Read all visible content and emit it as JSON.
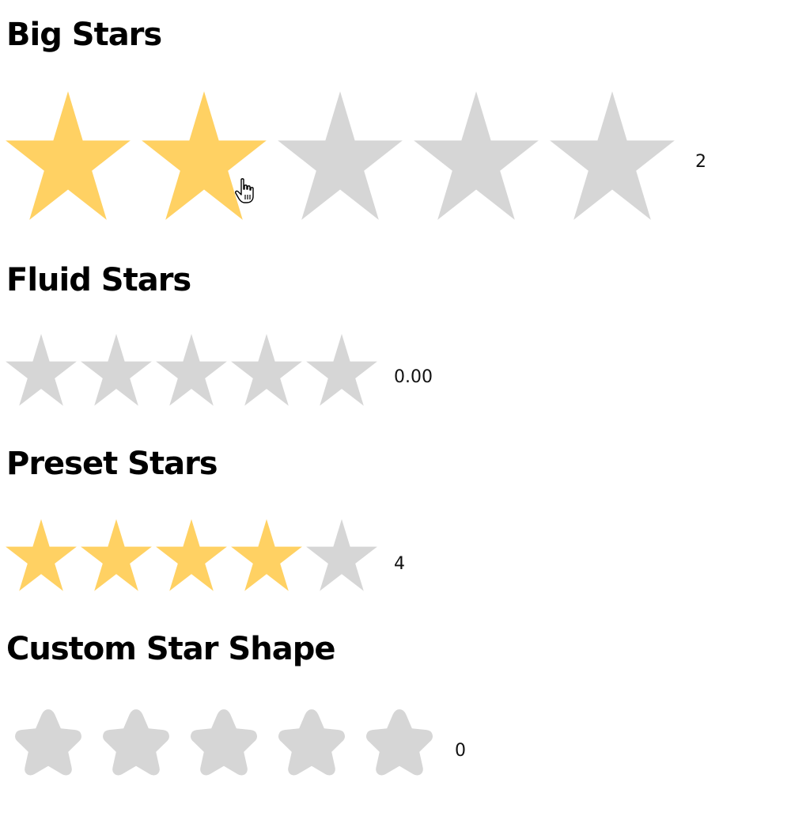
{
  "colors": {
    "filled": "#FFD163",
    "empty": "#D6D6D6"
  },
  "sections": [
    {
      "title": "Big Stars",
      "rating": 2,
      "max": 5,
      "value_text": "2",
      "shape": "classic-star-icon"
    },
    {
      "title": "Fluid Stars",
      "rating": 0,
      "max": 5,
      "value_text": "0.00",
      "shape": "classic-star-icon"
    },
    {
      "title": "Preset Stars",
      "rating": 4,
      "max": 5,
      "value_text": "4",
      "shape": "classic-star-icon"
    },
    {
      "title": "Custom Star Shape",
      "rating": 0,
      "max": 5,
      "value_text": "0",
      "shape": "rounded-star-icon"
    }
  ],
  "cursor": "pointer-hand-icon"
}
